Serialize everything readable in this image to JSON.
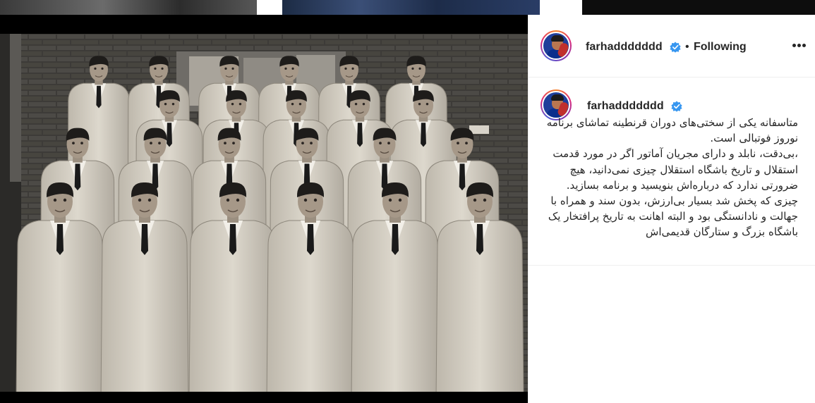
{
  "post": {
    "author": {
      "username": "farhaddddddd",
      "verified": true,
      "avatar_icon": "profile-avatar"
    },
    "follow_status": "Following",
    "separator": "•",
    "more_icon": "more-options-icon",
    "caption": {
      "username": "farhaddddddd",
      "text": "متاسفانه یکی از سختی‌های دوران قرنطینه تماشای برنامه نوروز فوتبالی است.\n،بی‌دقت، نابلد و دارای مجریان آماتور اگر در مورد قدمت استقلال و تاریخ باشگاه استقلال چیزی نمی‌دانید، هیچ ضرورتی ندارد که درباره‌اش بنویسید و برنامه بسازید. چیزی که پخش شد بسیار بی‌ارزش، بدون سند و همراه با جهالت و نادانستگی بود و البته اهانت به تاریخ پرافتخار یک باشگاه بزرگ و ستارگان قدیمی‌اش"
    },
    "media": {
      "type": "photo",
      "tone": "sepia-black-and-white"
    }
  },
  "colors": {
    "text_primary": "#262626",
    "verified_blue": "#3897f0",
    "border": "#efefef",
    "backdrop": "#000000"
  }
}
